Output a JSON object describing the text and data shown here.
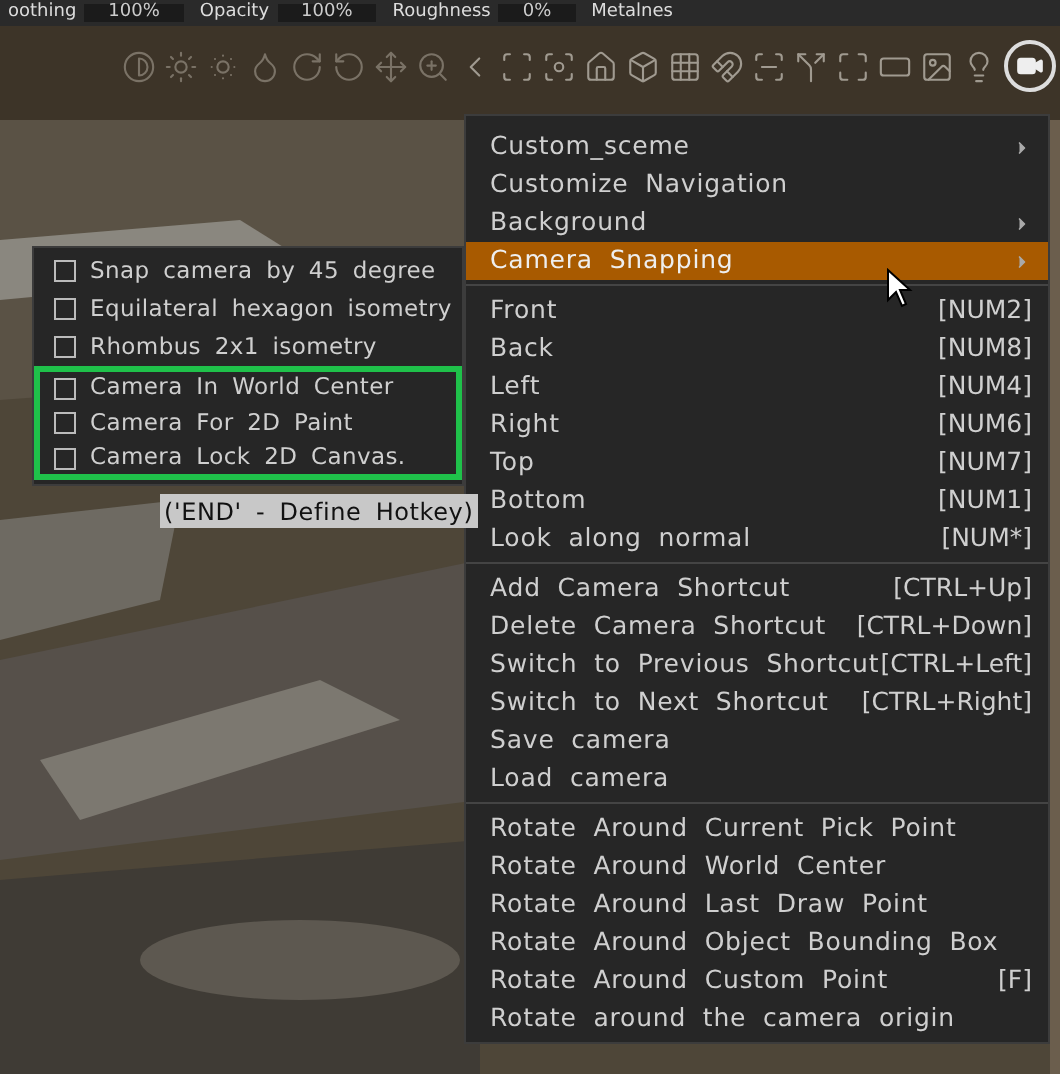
{
  "toolbar": {
    "fields": [
      {
        "label": "oothing",
        "value": "100%"
      },
      {
        "label": "Opacity",
        "value": "100%"
      },
      {
        "label": "Roughness",
        "value": "0%"
      },
      {
        "label": "Metalnes"
      }
    ]
  },
  "menu": {
    "sections": [
      [
        {
          "label": "Custom_sceme",
          "submenu": true,
          "selected": false
        },
        {
          "label": "Customize Navigation",
          "submenu": false,
          "selected": false
        },
        {
          "label": "Background",
          "submenu": true,
          "selected": false
        },
        {
          "label": "Camera Snapping",
          "submenu": true,
          "selected": true
        }
      ],
      [
        {
          "label": "Front",
          "shortcut": "[NUM2]",
          "selected": false
        },
        {
          "label": "Back",
          "shortcut": "[NUM8]",
          "selected": false
        },
        {
          "label": "Left",
          "shortcut": "[NUM4]",
          "selected": false
        },
        {
          "label": "Right",
          "shortcut": "[NUM6]",
          "selected": false
        },
        {
          "label": "Top",
          "shortcut": "[NUM7]",
          "selected": false
        },
        {
          "label": "Bottom",
          "shortcut": "[NUM1]",
          "selected": false
        },
        {
          "label": "Look along normal",
          "shortcut": "[NUM*]",
          "selected": false
        }
      ],
      [
        {
          "label": "Add Camera Shortcut",
          "shortcut": "[CTRL+Up]",
          "selected": false
        },
        {
          "label": "Delete Camera Shortcut",
          "shortcut": "[CTRL+Down]",
          "selected": false
        },
        {
          "label": "Switch to Previous Shortcut",
          "shortcut": "[CTRL+Left]",
          "selected": false
        },
        {
          "label": "Switch to Next Shortcut",
          "shortcut": "[CTRL+Right]",
          "selected": false
        },
        {
          "label": "Save camera",
          "selected": false
        },
        {
          "label": "Load camera",
          "selected": false
        }
      ],
      [
        {
          "label": "Rotate Around Current Pick Point",
          "selected": false
        },
        {
          "label": "Rotate Around World Center",
          "selected": false
        },
        {
          "label": "Rotate Around Last Draw Point",
          "selected": false
        },
        {
          "label": "Rotate Around Object Bounding Box",
          "selected": false
        },
        {
          "label": "Rotate Around Custom Point",
          "shortcut": "[F]",
          "selected": false
        },
        {
          "label": "Rotate around the camera origin",
          "selected": false
        }
      ]
    ]
  },
  "submenu": {
    "items": [
      {
        "label": "Snap camera by 45 degree",
        "checked": false,
        "highlighted": false
      },
      {
        "label": "Equilateral hexagon isometry",
        "checked": false,
        "highlighted": false
      },
      {
        "label": "Rhombus 2x1 isometry",
        "checked": false,
        "highlighted": false
      },
      {
        "label": "Camera In World Center",
        "checked": false,
        "highlighted": true
      },
      {
        "label": "Camera For 2D Paint",
        "checked": false,
        "highlighted": true
      },
      {
        "label": "Camera Lock 2D Canvas.",
        "checked": false,
        "highlighted": true
      }
    ],
    "tooltip": "('END' - Define Hotkey)"
  }
}
